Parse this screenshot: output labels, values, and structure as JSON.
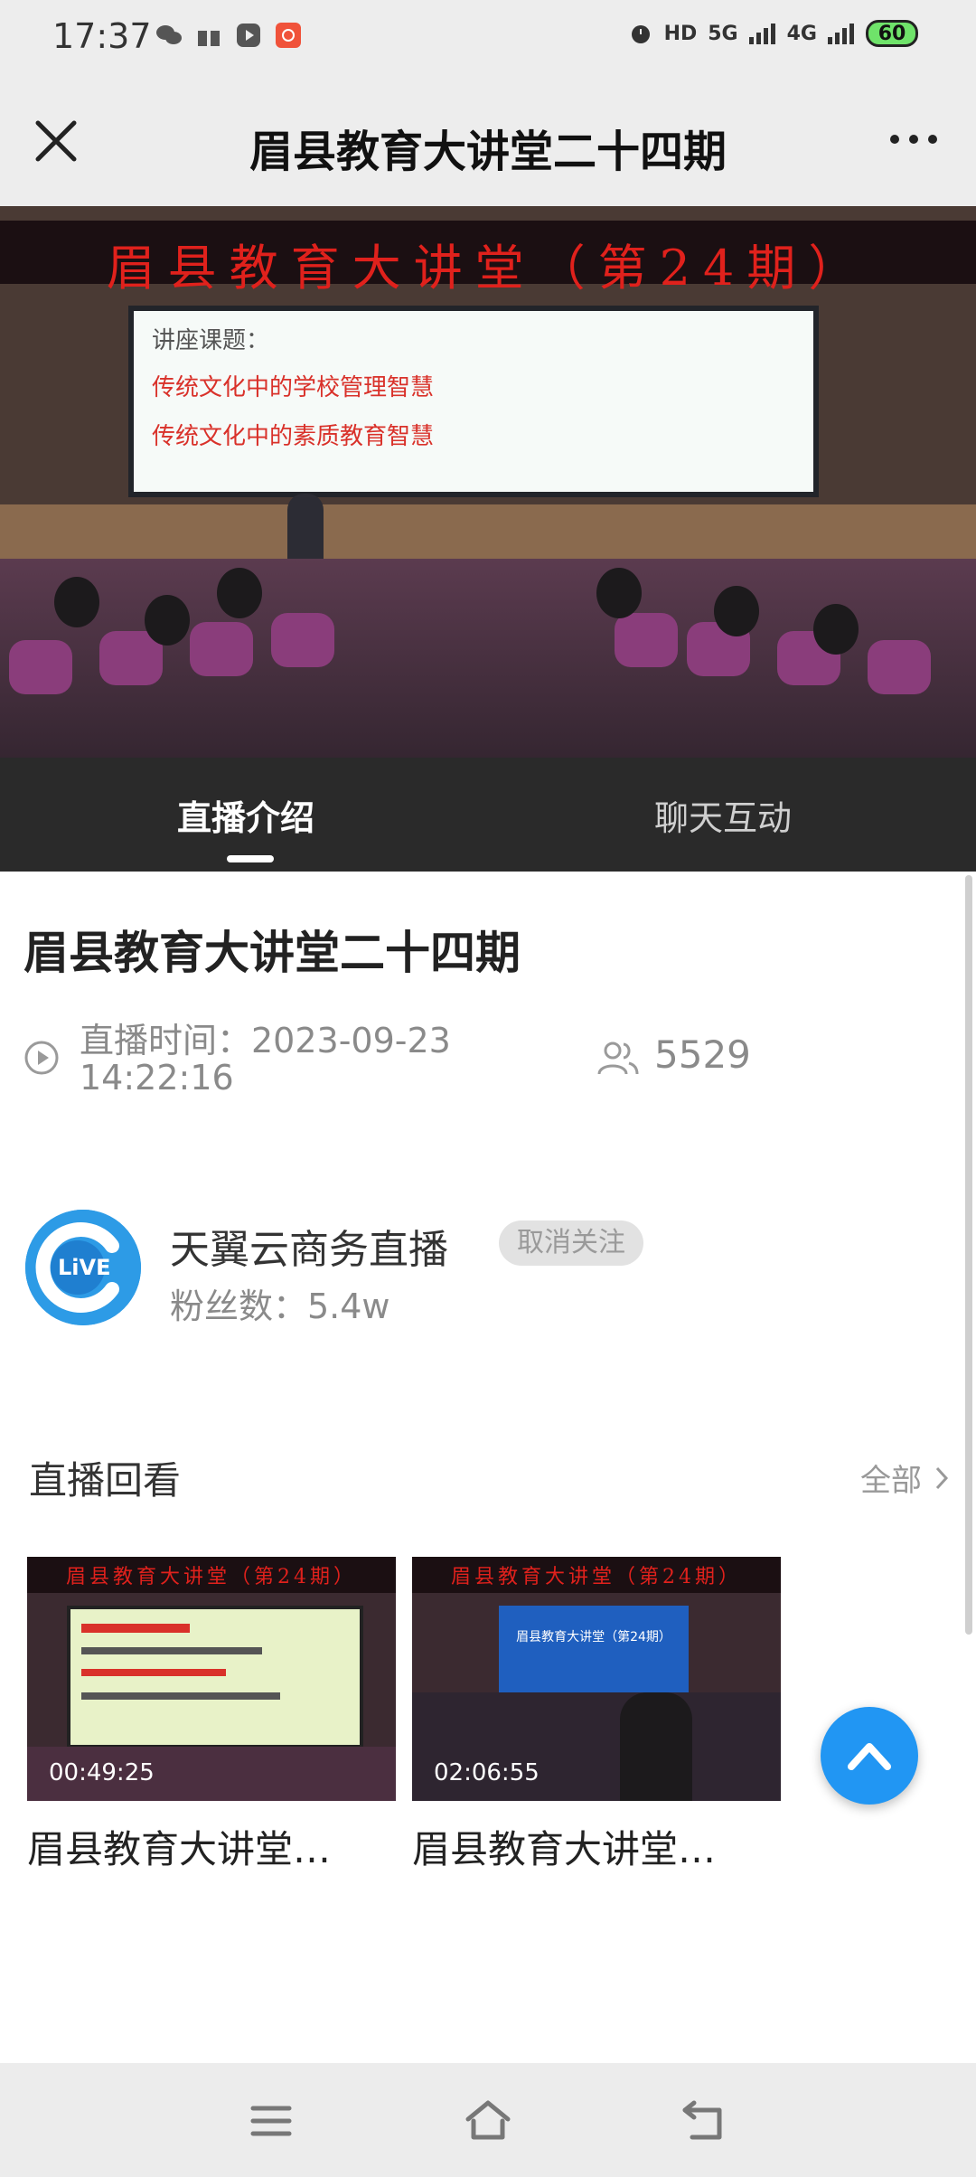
{
  "status_bar": {
    "time": "17:37",
    "network_left": "HD",
    "network_5g": "5G",
    "network_4g": "4G",
    "battery": "60"
  },
  "header": {
    "title": "眉县教育大讲堂二十四期"
  },
  "video": {
    "banner_text": "眉县教育大讲堂（第24期）",
    "slide_line_1": "讲座课题：",
    "slide_line_2": "传统文化中的学校管理智慧",
    "slide_line_3": "传统文化中的素质教育智慧"
  },
  "tabs": [
    {
      "label": "直播介绍",
      "active": true
    },
    {
      "label": "聊天互动",
      "active": false
    }
  ],
  "live": {
    "title": "眉县教育大讲堂二十四期",
    "time_label": "直播时间：2023-09-23",
    "time_value": "14:22:16",
    "viewers": "5529"
  },
  "channel": {
    "avatar_text": "LiVE",
    "name": "天翼云商务直播",
    "follow_label": "取消关注",
    "fans": "粉丝数：5.4w"
  },
  "replay": {
    "title": "直播回看",
    "all_label": "全部",
    "items": [
      {
        "title": "眉县教育大讲堂…",
        "duration": "00:49:25",
        "thumb_banner": "眉县教育大讲堂（第24期）"
      },
      {
        "title": "眉县教育大讲堂…",
        "duration": "02:06:55",
        "thumb_banner": "眉县教育大讲堂（第24期）",
        "screen_text": "眉县教育大讲堂（第24期）"
      }
    ]
  },
  "colors": {
    "accent": "#2196f3",
    "tab_bar": "#2a2a2a",
    "banner_red": "#e0211c"
  },
  "icons": [
    "close-icon",
    "more-icon",
    "play-circle-icon",
    "users-icon",
    "chevron-right-icon",
    "arrow-up-icon",
    "menu-icon",
    "home-icon",
    "back-icon"
  ]
}
